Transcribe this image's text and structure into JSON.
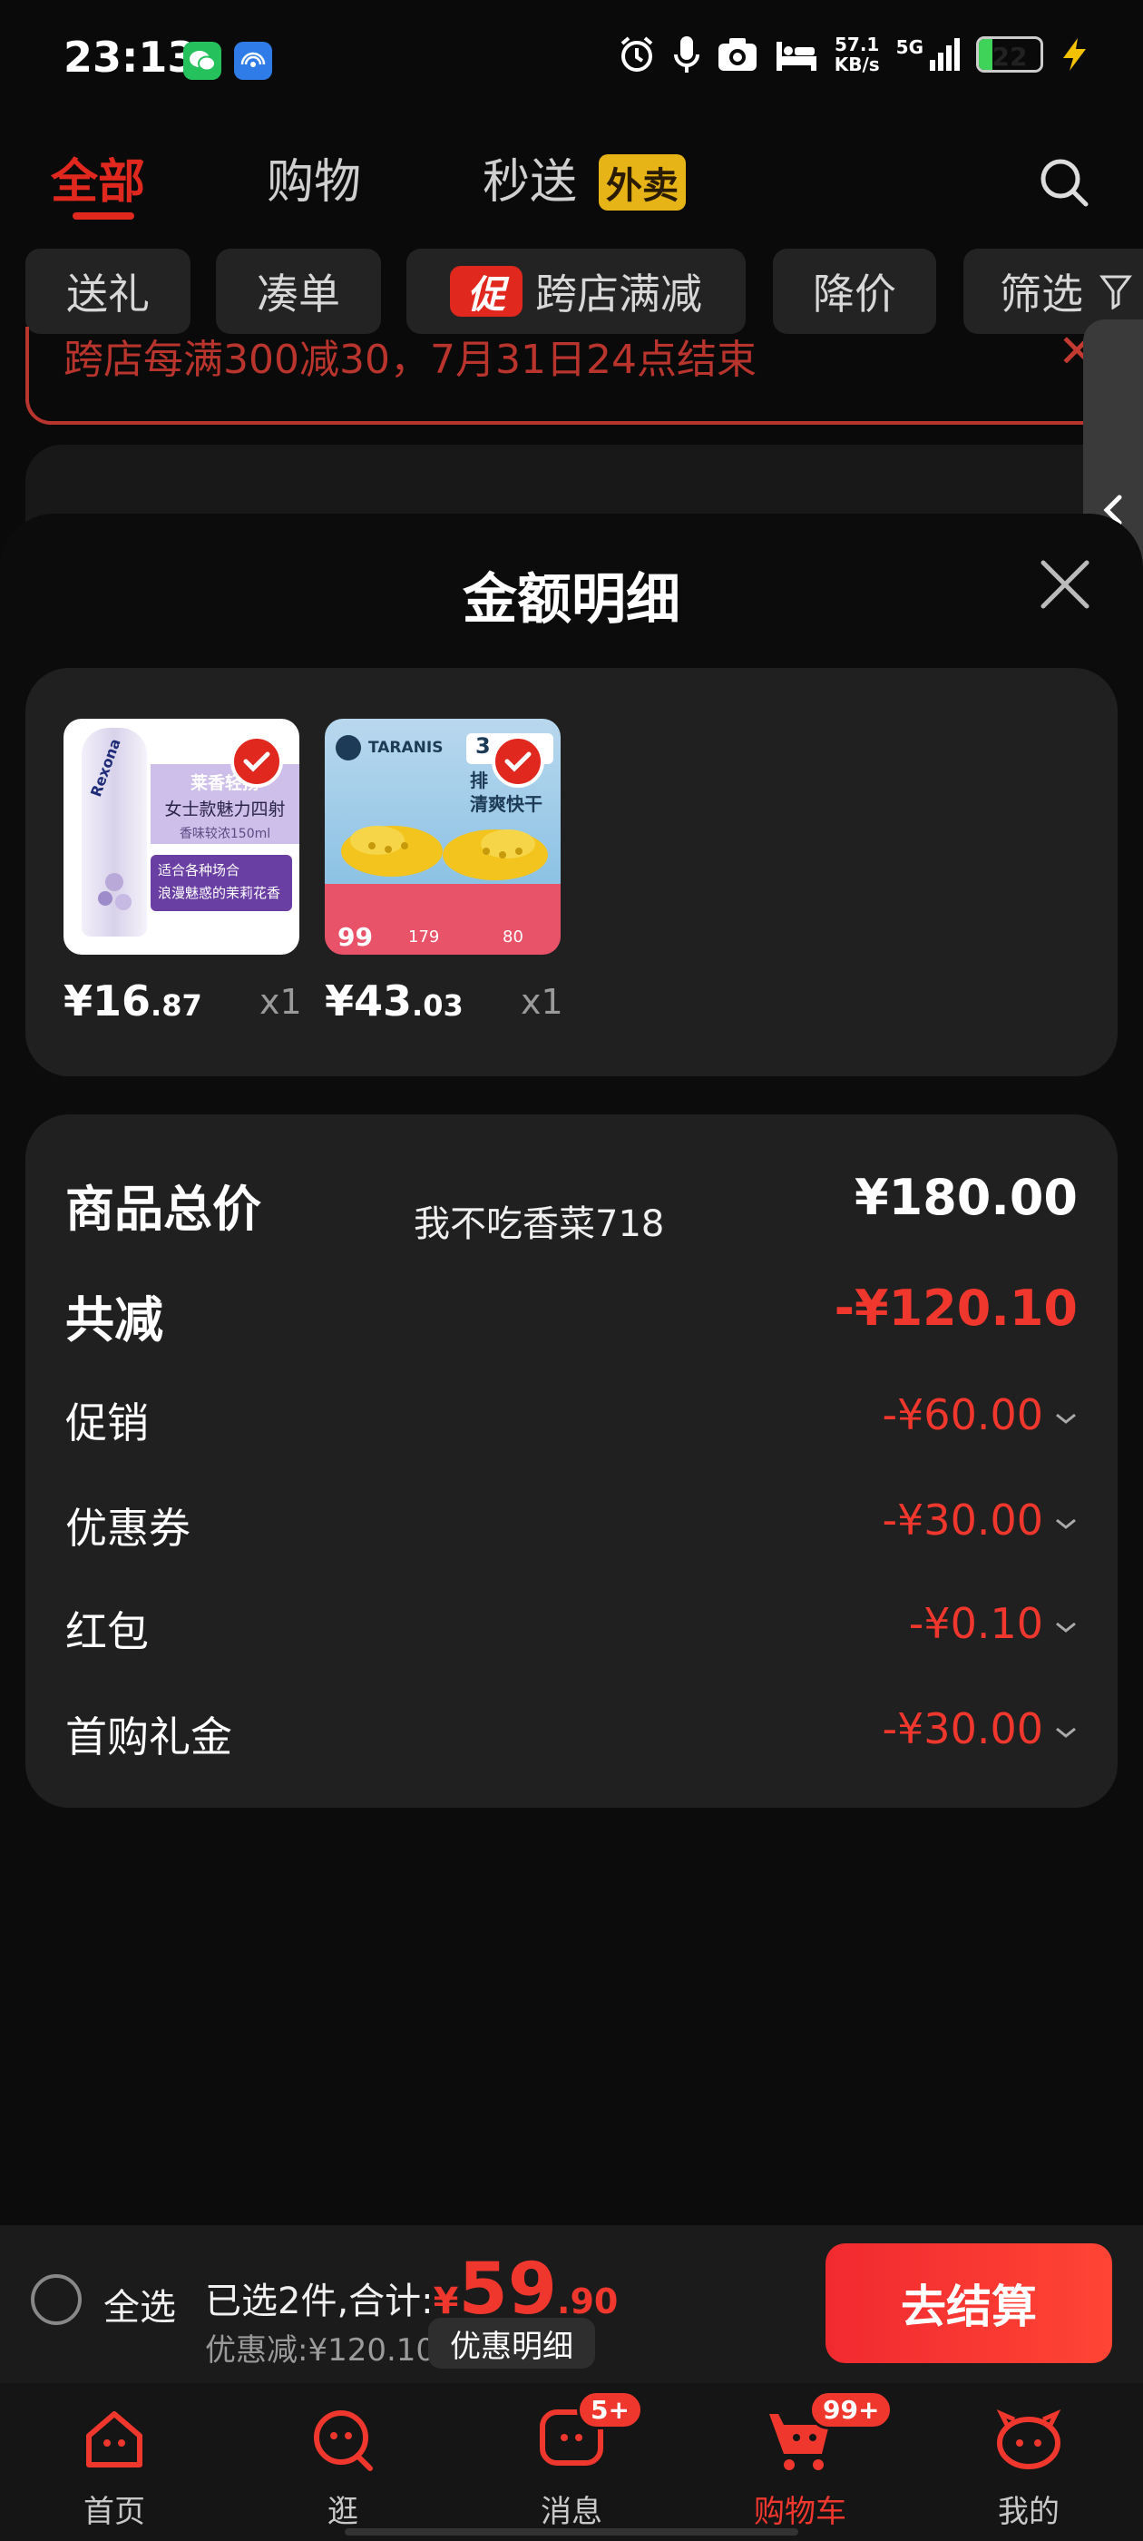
{
  "status_bar": {
    "time": "23:13",
    "network_speed": "57.1",
    "network_unit": "KB/s",
    "network_type": "5G",
    "battery": "22",
    "icons": [
      "wechat-icon",
      "hotspot-icon",
      "alarm-icon",
      "mic-icon",
      "camera-icon",
      "bed-icon",
      "signal-icon",
      "battery-icon",
      "charging-icon"
    ]
  },
  "top_tabs": {
    "all": "全部",
    "shopping": "购物",
    "instant": "秒送",
    "waimai_badge": "外卖"
  },
  "filters": [
    "送礼",
    "凑单",
    "跨店满减",
    "降价",
    "筛选"
  ],
  "promo_tag": "促",
  "banner": {
    "text": "跨店每满300减30，7月31日24点结束"
  },
  "sheet": {
    "title": "金额明细",
    "products": [
      {
        "price_main": "¥16",
        "price_decimal": ".87",
        "qty": "x1",
        "thumb_texts": [
          "莱香轻扬",
          "女士款魅力四射",
          "香味较浓150ml",
          "适合各种场合",
          "浪漫魅惑的茉莉花香",
          "Rexona"
        ]
      },
      {
        "price_main": "¥43",
        "price_decimal": ".03",
        "qty": "x1",
        "thumb_texts": [
          "TARANIS",
          "3",
          "排",
          "清爽快干",
          "99",
          "179",
          "80"
        ]
      }
    ],
    "summary": {
      "total_label": "商品总价",
      "total_value": "¥180.00",
      "reduction_label": "共减",
      "reduction_value": "-¥120.10",
      "items": [
        {
          "label": "促销",
          "value": "-¥60.00"
        },
        {
          "label": "优惠券",
          "value": "-¥30.00"
        },
        {
          "label": "红包",
          "value": "-¥0.10"
        },
        {
          "label": "首购礼金",
          "value": "-¥30.00"
        }
      ]
    },
    "watermark": "我不吃香菜718"
  },
  "checkout": {
    "select_all": "全选",
    "selected_text": "已选2件,合计:",
    "yen": "¥",
    "total_int": "59",
    "total_dec": ".90",
    "discount_text": "优惠减:¥120.10",
    "detail_button": "优惠明细",
    "checkout_button": "去结算"
  },
  "bottom_nav": [
    {
      "label": "首页",
      "icon": "home-icon"
    },
    {
      "label": "逛",
      "icon": "browse-icon"
    },
    {
      "label": "消息",
      "icon": "message-icon",
      "badge": "5+"
    },
    {
      "label": "购物车",
      "icon": "cart-icon",
      "badge": "99+",
      "active": true
    },
    {
      "label": "我的",
      "icon": "profile-icon"
    }
  ],
  "colors": {
    "accent_red": "#e0281e",
    "price_red": "#f0372d",
    "waimai_yellow": "#e6b416",
    "card_bg": "#202020"
  }
}
